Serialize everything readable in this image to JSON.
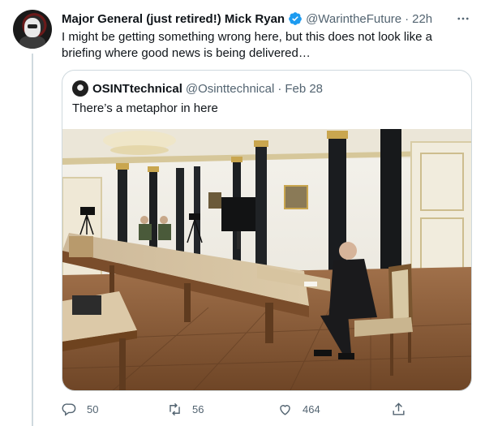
{
  "tweet": {
    "author_name": "Major General (just retired!) Mick Ryan",
    "handle": "@WarintheFuture",
    "separator": "·",
    "time": "22h",
    "text": "I might be getting something wrong here, but this does not look like a briefing where good news is being delivered…"
  },
  "quote": {
    "author_name": "OSINTtechnical",
    "handle": "@Osinttechnical",
    "separator": "·",
    "time": "Feb 28",
    "text": "There’s a metaphor in here"
  },
  "actions": {
    "reply_count": "50",
    "retweet_count": "56",
    "like_count": "464"
  },
  "colors": {
    "verified": "#1d9bf0",
    "secondary_text": "#536471",
    "border": "#cfd9de"
  },
  "icons": [
    "more-icon",
    "verified-badge-icon",
    "reply-icon",
    "retweet-icon",
    "like-icon",
    "share-icon"
  ]
}
